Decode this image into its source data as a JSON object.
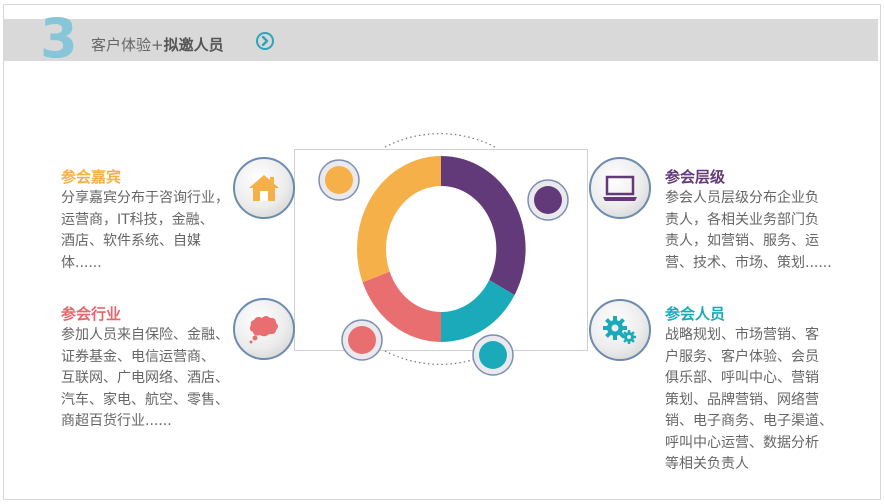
{
  "header": {
    "number": "3",
    "title_prefix": "客户体验+",
    "title_bold": "拟邀人员"
  },
  "blocks": {
    "guests": {
      "title": "参会嘉宾",
      "lines": [
        "分享嘉宾分布于咨询行业，",
        "运营商，IT科技，金融、",
        "酒店、软件系统、自媒",
        "体......"
      ]
    },
    "industry": {
      "title": "参会行业",
      "lines": [
        "参加人员来自保险、金融、",
        "证券基金、电信运营商、",
        "互联网、广电网络、酒店、",
        "汽车、家电、航空、零售、",
        "商超百货行业......"
      ]
    },
    "level": {
      "title": "参会层级",
      "lines": [
        "参会人员层级分布企业负",
        "责人，各相关业务部门负",
        "责人，如营销、服务、运",
        "营、技术、市场、策划......"
      ]
    },
    "staff": {
      "title": "参会人员",
      "lines": [
        "战略规划、市场营销、客",
        "户服务、客户体验、会员",
        "俱乐部、呼叫中心、营销",
        "策划、品牌营销、网络营",
        "销、电子商务、电子渠道、",
        "呼叫中心运营、数据分析",
        "等相关负责人"
      ]
    }
  },
  "colors": {
    "guests": "#f6b04a",
    "industry": "#e5676b",
    "level": "#633a79",
    "staff": "#1aaab9",
    "hdr_num": "#86c6d8"
  },
  "icons": {
    "guests": "house-icon",
    "industry": "speech-bubble-icon",
    "level": "laptop-icon",
    "staff": "gears-icon",
    "header": "arrow-right-circle-icon"
  }
}
